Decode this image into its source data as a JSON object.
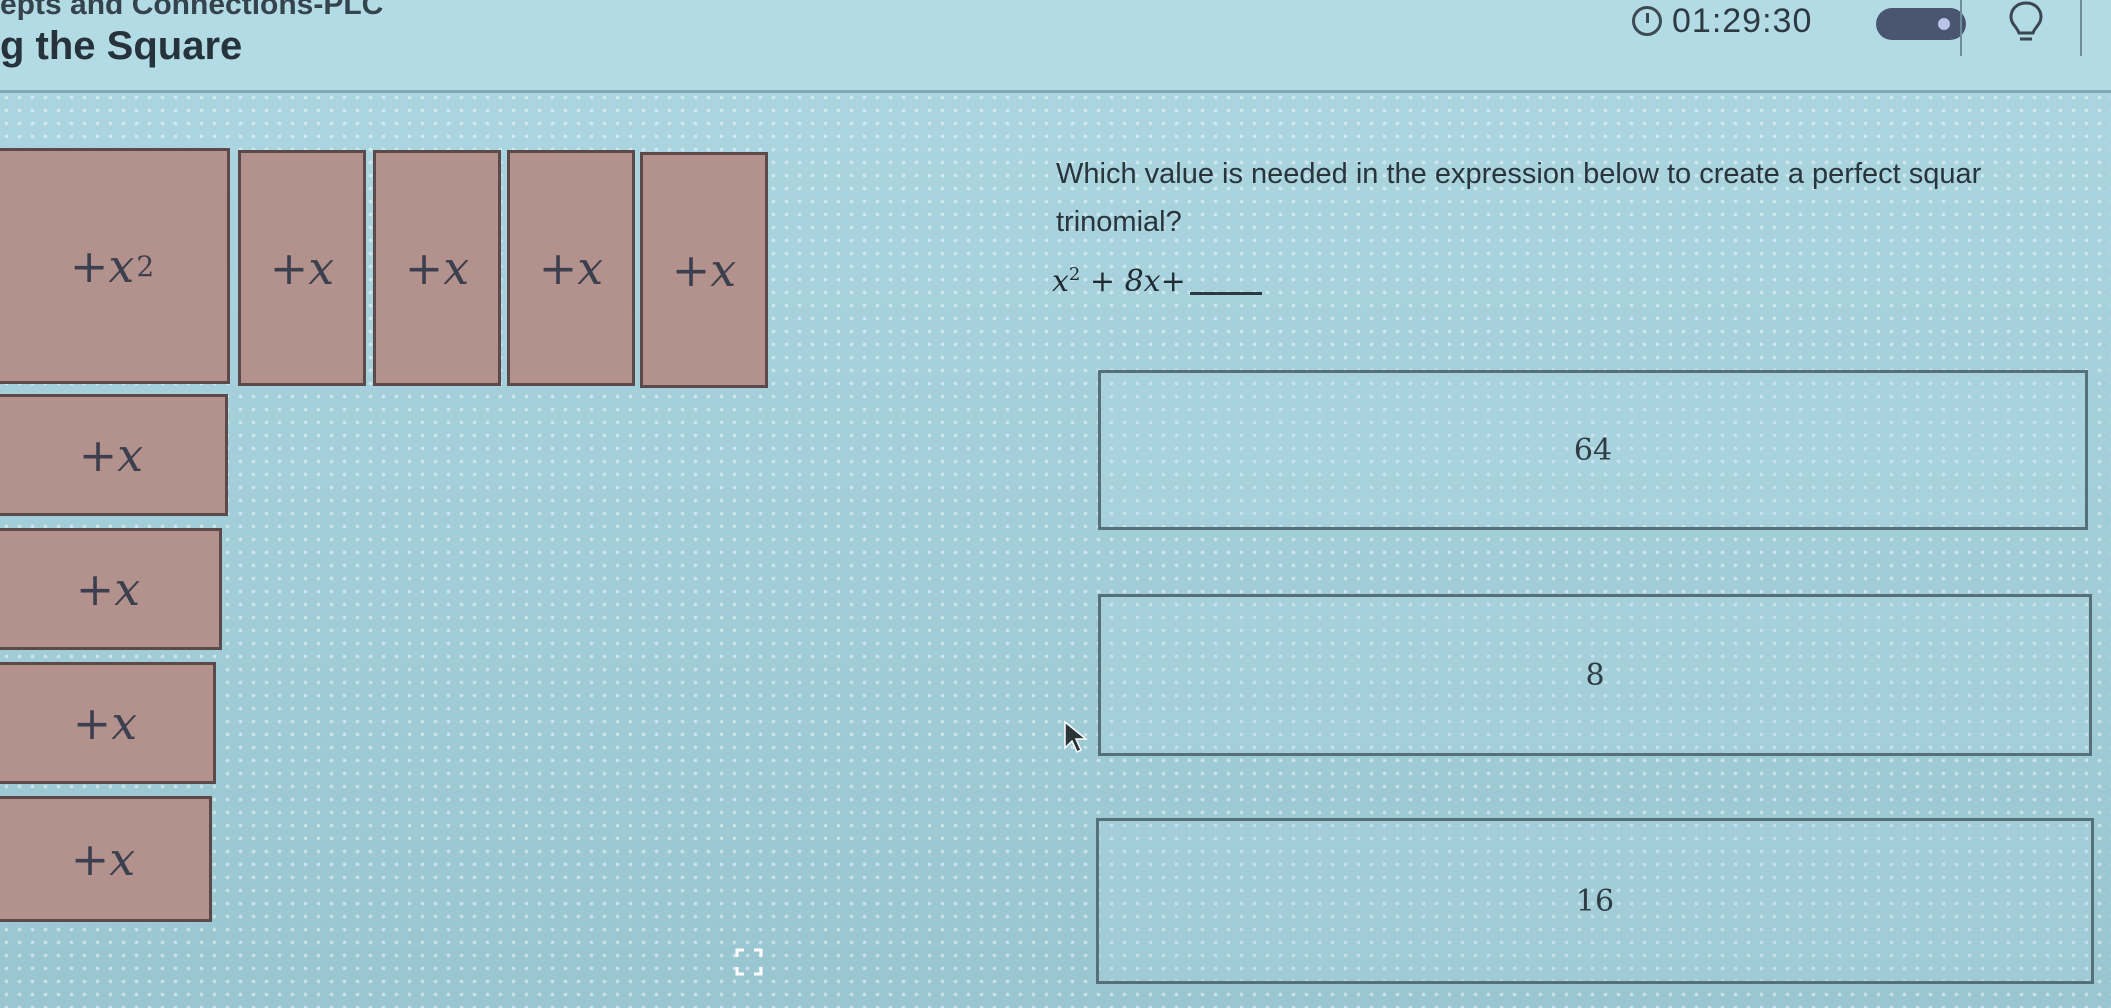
{
  "header": {
    "top_cut_text": "epts and Connections-PLC",
    "lesson_title": "g the Square",
    "timer": "01:29:30",
    "timer_icon": "timer-icon",
    "toggle_icon": "toggle-switch",
    "hint_icon": "lightbulb-icon"
  },
  "tiles": {
    "x_squared": {
      "label": "+x",
      "exponent": "2"
    },
    "top_row": [
      "+x",
      "+x",
      "+x",
      "+x"
    ],
    "left_column": [
      "+x",
      "+x",
      "+x",
      "+x"
    ]
  },
  "question": {
    "text": "Which value is needed in the expression below to create a perfect squar trinomial?",
    "expression_base": "x",
    "expression_exp": "2",
    "expression_rest": " + 8x+"
  },
  "choices": [
    "64",
    "8",
    "16"
  ],
  "colors": {
    "tile_fill": "#b3928d",
    "tile_border": "#5b4a49",
    "background": "#a3d2de"
  }
}
